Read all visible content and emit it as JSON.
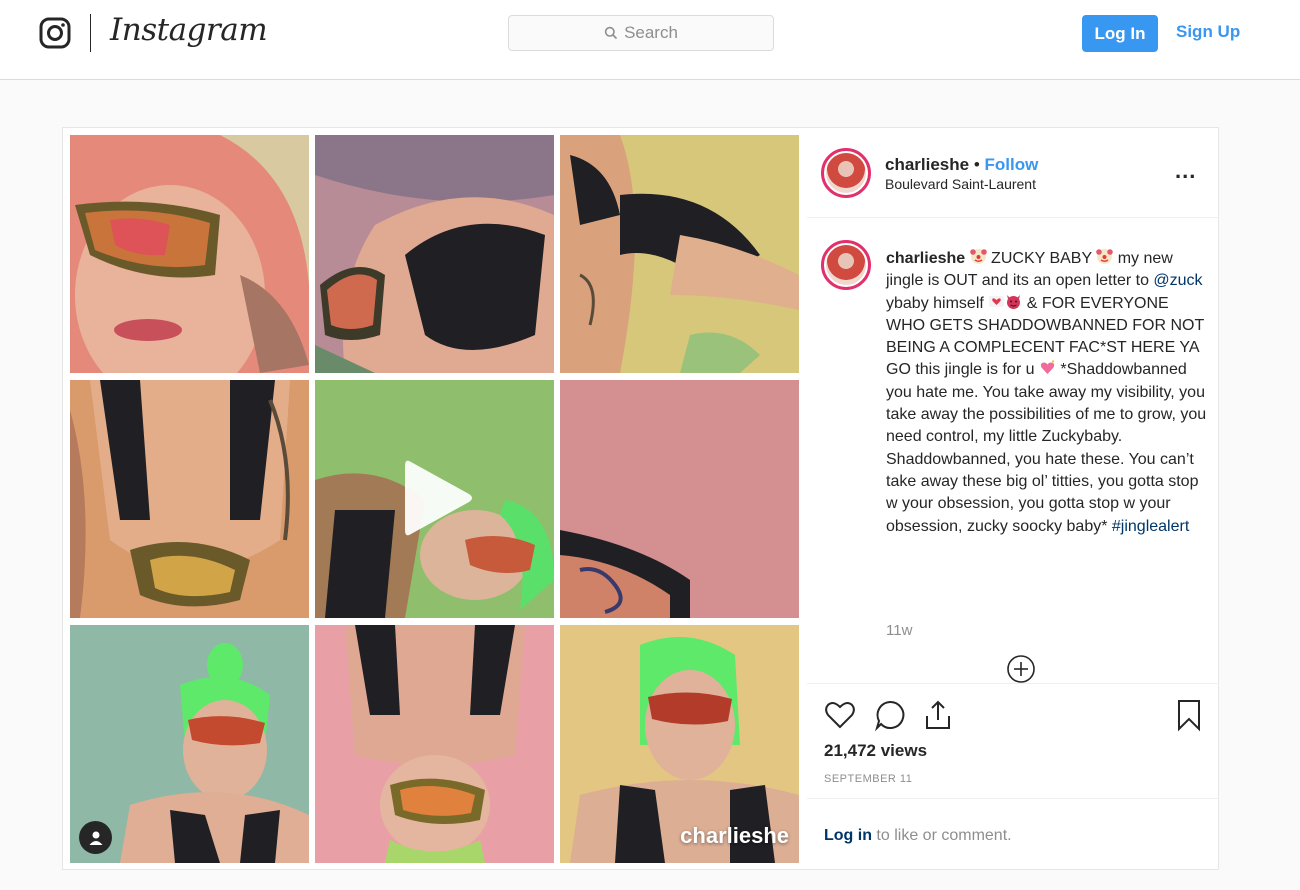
{
  "app": {
    "wordmark": "Instagram",
    "search_placeholder": "Search",
    "login_label": "Log In",
    "signup_label": "Sign Up",
    "accent_color": "#3897f0"
  },
  "post": {
    "username": "charlieshe",
    "separator": " • ",
    "follow_label": "Follow",
    "location": "Boulevard Saint-Laurent",
    "more_label": "...",
    "caption": {
      "username": "charlieshe",
      "part1": " ZUCKY BABY ",
      "part2": " my new jingle is OUT and its an open letter to ",
      "mention": "@zuck",
      "part3": " ybaby himself ",
      "part4": " & FOR EVERYONE WHO GETS SHADDOWBANNED FOR NOT BEING A COMPLECENT FAC*ST HERE YA GO this jingle is for u ",
      "part5": " *Shaddowbanned you hate me. You take away my visibility, you take away the possibilities of me to grow, you need control, my little Zuckybaby. Shaddowbanned, you hate these. You can’t take away these big ol’ titties, you gotta stop w your obsession, you gotta stop w your obsession, zucky soocky baby* ",
      "hashtag": "#jinglealert"
    },
    "time_ago": "11w",
    "views": "21,472 views",
    "date": "SEPTEMBER 11",
    "login_prompt_link": "Log in",
    "login_prompt_rest": " to like or comment.",
    "watermark": "charlieshe"
  },
  "grid": {
    "tiles": [
      {
        "id": 1,
        "bg": "#e58a7a"
      },
      {
        "id": 2,
        "bg": "#b88c97"
      },
      {
        "id": 3,
        "bg": "#d7c77a"
      },
      {
        "id": 4,
        "bg": "#d99a6c"
      },
      {
        "id": 5,
        "bg": "#8fbf6c",
        "video": true
      },
      {
        "id": 6,
        "bg": "#d48f91"
      },
      {
        "id": 7,
        "bg": "#8fb8a7"
      },
      {
        "id": 8,
        "bg": "#e8a0a6"
      },
      {
        "id": 9,
        "bg": "#e3c681"
      }
    ]
  },
  "icons": [
    "instagram-logo-icon",
    "search-icon",
    "more-icon",
    "clown-emoji-icon",
    "heart-emoji-icon",
    "devil-emoji-icon",
    "sparkle-heart-emoji-icon",
    "play-icon",
    "user-tag-icon",
    "load-more-icon",
    "heart-icon",
    "comment-icon",
    "share-icon",
    "bookmark-icon"
  ]
}
